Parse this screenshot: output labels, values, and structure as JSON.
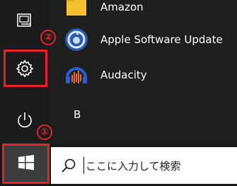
{
  "apps": [
    {
      "label": "Amazon",
      "icon": "amazon-folder-icon"
    },
    {
      "label": "Apple Software Update",
      "icon": "apple-software-update-icon"
    },
    {
      "label": "Audacity",
      "icon": "audacity-icon"
    }
  ],
  "section_letter": "B",
  "rail": {
    "items": [
      {
        "icon": "pictures-icon"
      },
      {
        "icon": "gear-icon"
      },
      {
        "icon": "power-icon"
      }
    ]
  },
  "annotations": {
    "settings_badge": "②",
    "start_badge": "①",
    "highlight_color": "#e8212b"
  },
  "taskbar": {
    "start_icon": "windows-logo-icon",
    "search": {
      "placeholder": "ここに入力して検索",
      "icon": "search-icon"
    }
  }
}
